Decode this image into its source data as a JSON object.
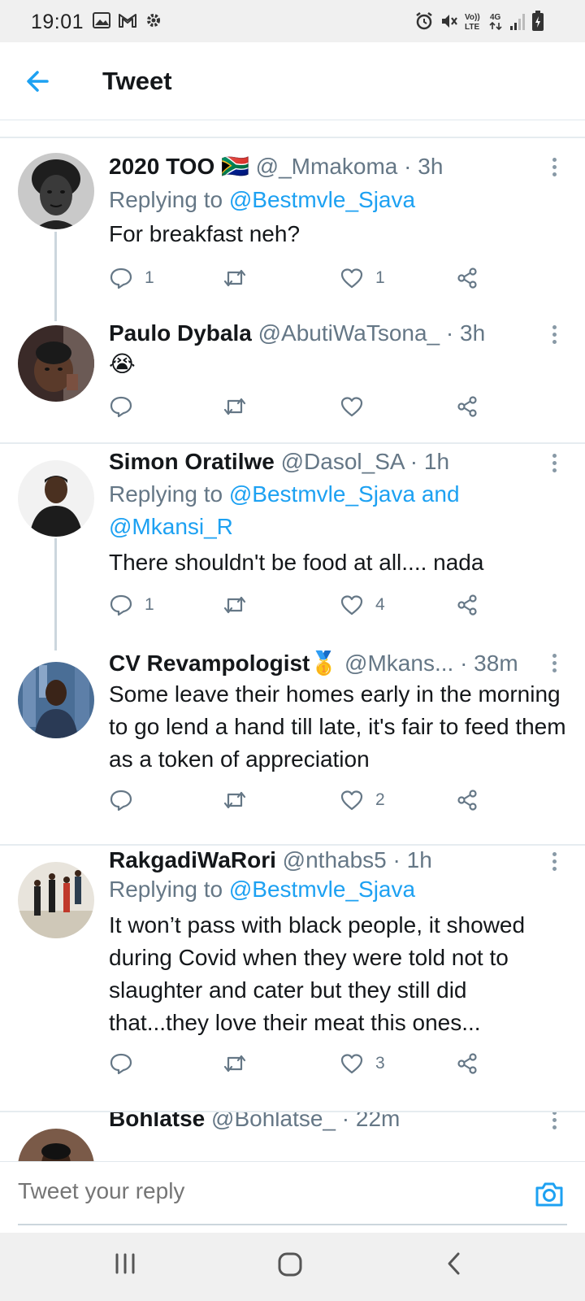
{
  "status_bar": {
    "time": "19:01",
    "left_icons": [
      "image-icon",
      "gmail-icon",
      "gear-icon"
    ],
    "right_icons": [
      "alarm-icon",
      "mute-icon",
      "volte-icon",
      "4g-icon",
      "signal-icon",
      "battery-icon"
    ],
    "volte": "Vo)) LTE",
    "network": "4G"
  },
  "header": {
    "title": "Tweet",
    "back_icon": "back-arrow-icon"
  },
  "tweets": [
    {
      "name": "2020 TOO",
      "flag": "🇿🇦",
      "handle": "@_Mmakoma",
      "time": "3h",
      "replying_prefix": "Replying to ",
      "replying_to": "@Bestmvle_Sjava",
      "text": "For breakfast neh?",
      "counts": {
        "reply": "1",
        "retweet": "",
        "like": "1"
      }
    },
    {
      "name": "Paulo Dybala",
      "handle": "@AbutiWaTsona_",
      "time": "3h",
      "text": "😭",
      "counts": {
        "reply": "",
        "retweet": "",
        "like": ""
      }
    },
    {
      "name": "Simon Oratilwe",
      "handle": "@Dasol_SA",
      "time": "1h",
      "replying_prefix": "Replying to ",
      "replying_to": "@Bestmvle_Sjava and @Mkansi_R",
      "text": "There shouldn't be food at all.... nada",
      "counts": {
        "reply": "1",
        "retweet": "",
        "like": "4"
      }
    },
    {
      "name": "CV Revampologist",
      "badge": "🥇",
      "handle": "@Mkans...",
      "time": "38m",
      "text": "Some leave their homes early in the morning to go lend a hand till late, it's fair to feed them as a token of appreciation",
      "counts": {
        "reply": "",
        "retweet": "",
        "like": "2"
      }
    },
    {
      "name": "RakgadiWaRori",
      "handle": "@nthabs5",
      "time": "1h",
      "replying_prefix": "Replying to ",
      "replying_to": "@Bestmvle_Sjava",
      "text": "It won’t pass with black people, it showed during Covid when they were told not to slaughter and cater but they still did that...they love their meat this ones...",
      "counts": {
        "reply": "",
        "retweet": "",
        "like": "3"
      }
    },
    {
      "name": "Bohlatse",
      "handle": "@Bohlatse_",
      "time": "22m"
    }
  ],
  "reply_bar": {
    "placeholder": "Tweet your reply",
    "camera_icon": "camera-icon"
  },
  "nav_bar": {
    "icons": [
      "recent-apps-icon",
      "home-icon",
      "back-icon"
    ]
  },
  "colors": {
    "accent": "#1da1f2",
    "secondary_text": "#657786",
    "divider": "#e6ecf0"
  }
}
